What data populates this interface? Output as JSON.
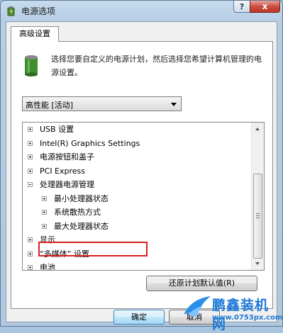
{
  "window": {
    "title": "电源选项",
    "help_label": "?",
    "close_label": "x"
  },
  "tabs": [
    {
      "label": "高级设置"
    }
  ],
  "description": "选择您要自定义的电源计划，然后选择您希望计算机管理的电源设置。",
  "plan_select": {
    "value": "高性能 [活动]"
  },
  "tree": {
    "items": [
      {
        "label": "USB 设置",
        "level": 0,
        "expander": "plus"
      },
      {
        "label": "Intel(R) Graphics Settings",
        "level": 0,
        "expander": "plus"
      },
      {
        "label": "电源按钮和盖子",
        "level": 0,
        "expander": "plus"
      },
      {
        "label": "PCI Express",
        "level": 0,
        "expander": "plus"
      },
      {
        "label": "处理器电源管理",
        "level": 0,
        "expander": "minus"
      },
      {
        "label": "最小处理器状态",
        "level": 1,
        "expander": "plus"
      },
      {
        "label": "系统散热方式",
        "level": 1,
        "expander": "plus"
      },
      {
        "label": "最大处理器状态",
        "level": 1,
        "expander": "plus"
      },
      {
        "label": "显示",
        "level": 0,
        "expander": "plus"
      },
      {
        "label": "“多媒体” 设置",
        "level": 0,
        "expander": "plus"
      },
      {
        "label": "电池",
        "level": 0,
        "expander": "plus"
      }
    ]
  },
  "buttons": {
    "restore": "还原计划默认值(R)",
    "ok": "确定",
    "cancel": "取消"
  },
  "watermark": {
    "brand_a": "鹏鑫",
    "brand_b": "装机网",
    "url": "www.0753px.com"
  },
  "colors": {
    "highlight": "#d8201f",
    "brand": "#1d78d6",
    "title_bar": "#b6cde4"
  }
}
